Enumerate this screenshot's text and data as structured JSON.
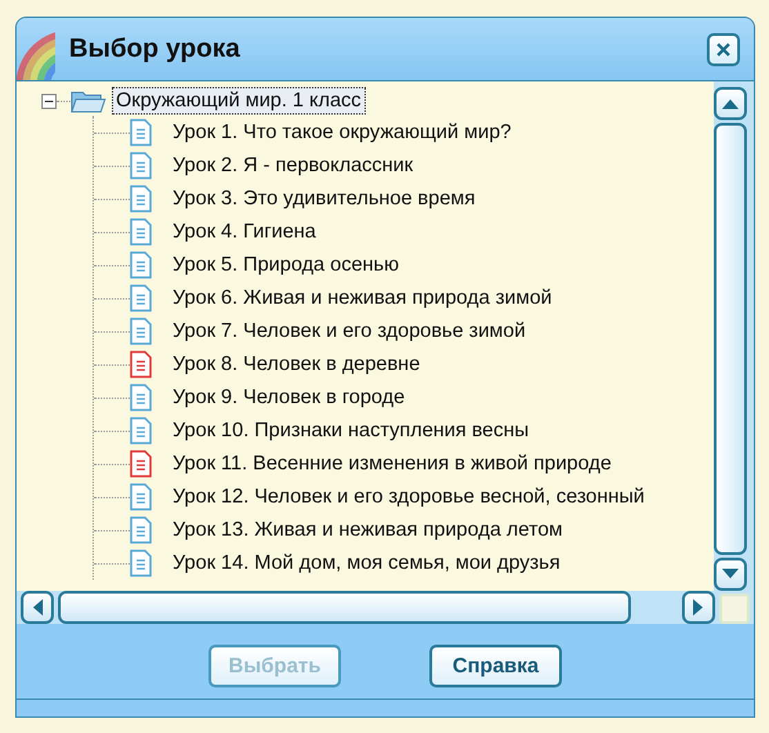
{
  "window": {
    "title": "Выбор урока"
  },
  "tree": {
    "label": "Окружающий мир. 1 класс",
    "expanded": true,
    "selected": true,
    "children": [
      {
        "label": "Урок 1. Что такое окружающий мир?",
        "color": "#5aaad8",
        "selected": false
      },
      {
        "label": "Урок 2. Я - первоклассник",
        "color": "#5aaad8",
        "selected": false
      },
      {
        "label": "Урок 3. Это удивительное время",
        "color": "#5aaad8",
        "selected": false
      },
      {
        "label": "Урок 4. Гигиена",
        "color": "#5aaad8",
        "selected": false
      },
      {
        "label": "Урок 5. Природа осенью",
        "color": "#5aaad8",
        "selected": false
      },
      {
        "label": "Урок 6. Живая и неживая природа зимой",
        "color": "#5aaad8",
        "selected": false
      },
      {
        "label": "Урок 7. Человек и его здоровье зимой",
        "color": "#5aaad8",
        "selected": false
      },
      {
        "label": "Урок 8. Человек в деревне",
        "color": "#e03a3a",
        "selected": false
      },
      {
        "label": "Урок 9. Человек в городе",
        "color": "#5aaad8",
        "selected": false
      },
      {
        "label": "Урок 10. Признаки наступления весны",
        "color": "#5aaad8",
        "selected": false
      },
      {
        "label": "Урок 11. Весенние изменения в живой природе",
        "color": "#e03a3a",
        "selected": false
      },
      {
        "label": "Урок 12. Человек и его здоровье весной, сезонный",
        "color": "#5aaad8",
        "selected": false
      },
      {
        "label": "Урок 13. Живая и неживая природа летом",
        "color": "#5aaad8",
        "selected": false
      },
      {
        "label": "Урок 14. Мой дом, моя семья, мои друзья",
        "color": "#5aaad8",
        "selected": false
      }
    ]
  },
  "buttons": [
    {
      "label": "Выбрать",
      "disabled": true
    },
    {
      "label": "Справка",
      "disabled": false
    }
  ]
}
